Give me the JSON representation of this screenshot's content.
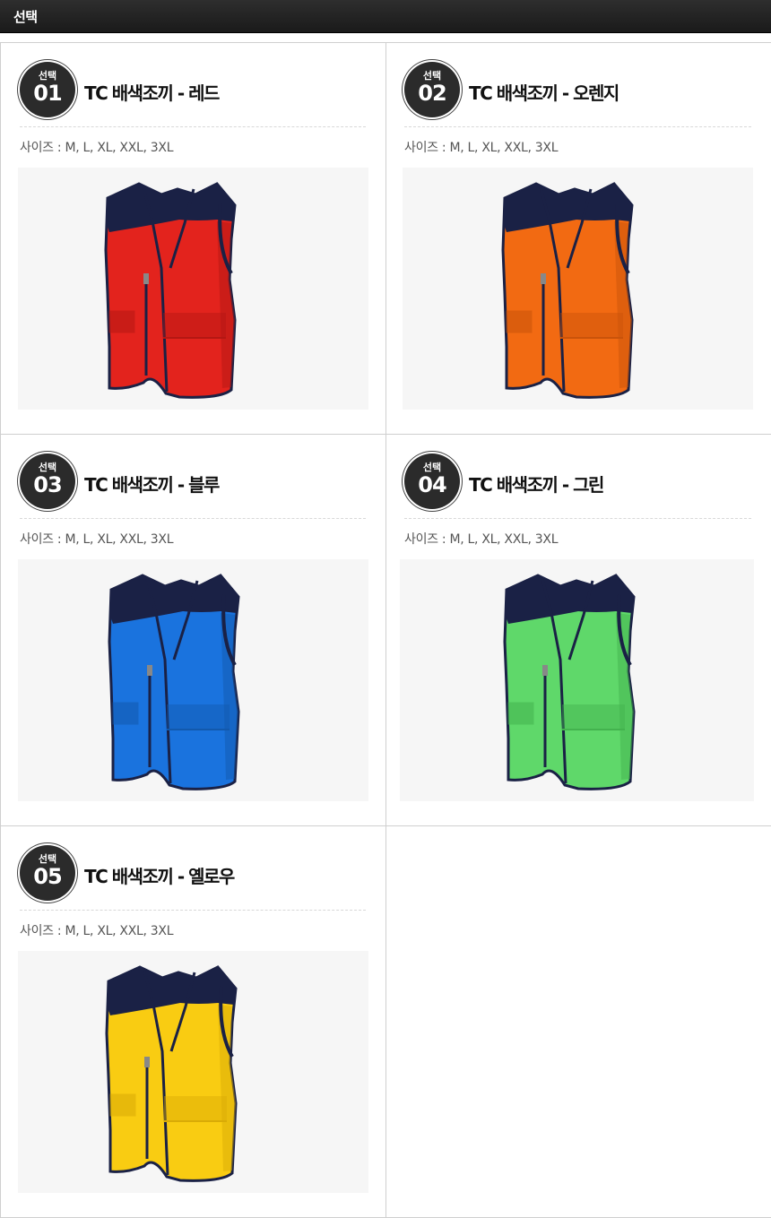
{
  "header": {
    "title": "선택"
  },
  "products": [
    {
      "badge_label": "선택",
      "number": "01",
      "title": "TC 배색조끼 - 레드",
      "sizes": "사이즈 : M, L, XL, XXL, 3XL",
      "color": "#e3231d",
      "dark": "#b41713"
    },
    {
      "badge_label": "선택",
      "number": "02",
      "title": "TC 배색조끼 - 오렌지",
      "sizes": "사이즈 : M, L, XL, XXL, 3XL",
      "color": "#f26a12",
      "dark": "#c9530a"
    },
    {
      "badge_label": "선택",
      "number": "03",
      "title": "TC 배색조끼 - 블루",
      "sizes": "사이즈 : M, L, XL, XXL, 3XL",
      "color": "#1a73de",
      "dark": "#1259ad"
    },
    {
      "badge_label": "선택",
      "number": "04",
      "title": "TC 배색조끼 - 그린",
      "sizes": "사이즈 : M, L, XL, XXL, 3XL",
      "color": "#5fd86a",
      "dark": "#43b24e"
    },
    {
      "badge_label": "선택",
      "number": "05",
      "title": "TC 배색조끼 - 옐로우",
      "sizes": "사이즈 : M, L, XL, XXL, 3XL",
      "color": "#f9cc12",
      "dark": "#d9ab06"
    }
  ],
  "vest_trim_color": "#1a2145"
}
